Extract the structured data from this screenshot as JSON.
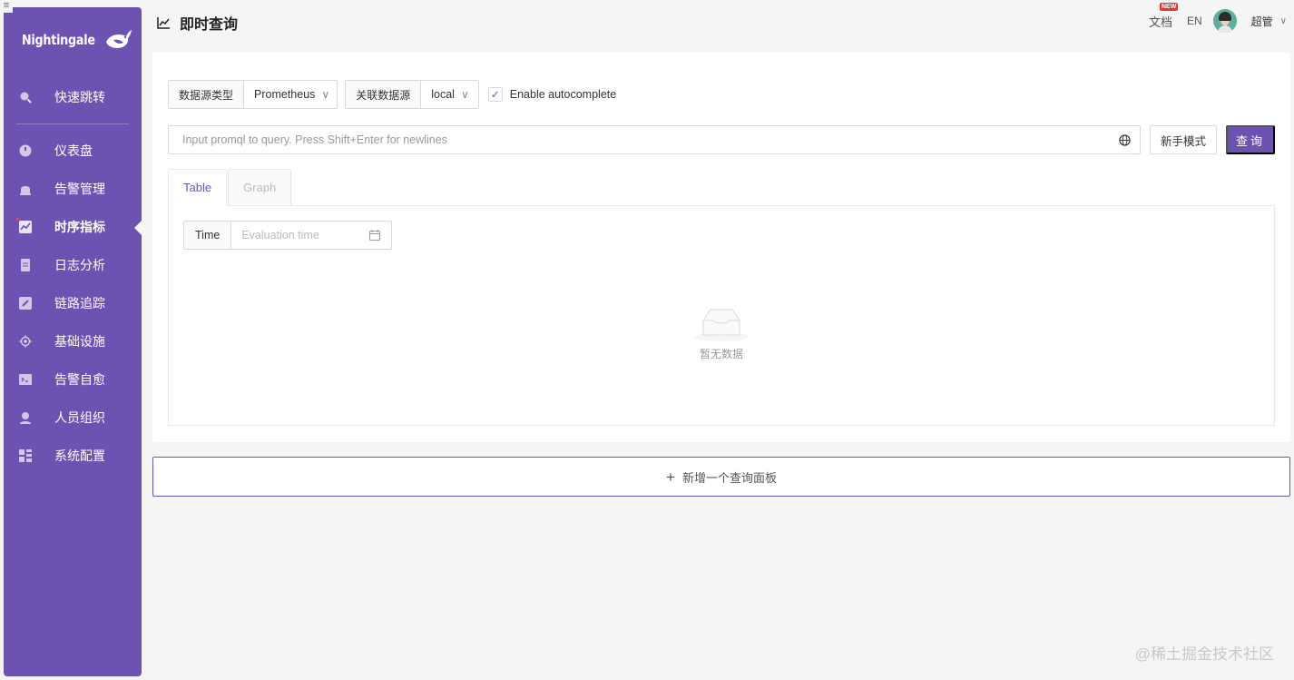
{
  "sidebar": {
    "logo_text": "Nightingale",
    "collapse_icon": "menu-lines-icon",
    "items": [
      {
        "label": "快速跳转",
        "icon": "search-icon",
        "active": false
      },
      {
        "label": "仪表盘",
        "icon": "dashboard-icon",
        "active": false
      },
      {
        "label": "告警管理",
        "icon": "alarm-icon",
        "active": false
      },
      {
        "label": "时序指标",
        "icon": "line-chart-icon",
        "active": true
      },
      {
        "label": "日志分析",
        "icon": "document-icon",
        "active": false
      },
      {
        "label": "链路追踪",
        "icon": "edit-trace-icon",
        "active": false
      },
      {
        "label": "基础设施",
        "icon": "target-icon",
        "active": false
      },
      {
        "label": "告警自愈",
        "icon": "terminal-icon",
        "active": false
      },
      {
        "label": "人员组织",
        "icon": "user-icon",
        "active": false
      },
      {
        "label": "系统配置",
        "icon": "grid-settings-icon",
        "active": false
      }
    ]
  },
  "header": {
    "title": "即时查询",
    "doc_link": "文档",
    "new_badge": "NEW",
    "lang": "EN",
    "username": "超管"
  },
  "query": {
    "datasource_type_label": "数据源类型",
    "datasource_type_value": "Prometheus",
    "linked_datasource_label": "关联数据源",
    "linked_datasource_value": "local",
    "autocomplete_label": "Enable autocomplete",
    "autocomplete_checked": true,
    "promql_placeholder": "Input promql to query. Press Shift+Enter for newlines",
    "novice_mode_button": "新手模式",
    "query_button": "查询",
    "tabs": [
      {
        "label": "Table",
        "active": true
      },
      {
        "label": "Graph",
        "active": false
      }
    ],
    "time_label": "Time",
    "time_placeholder": "Evaluation time",
    "empty_text": "暂无数据"
  },
  "add_panel_label": "新增一个查询面板",
  "watermark": "@稀土掘金技术社区",
  "colors": {
    "primary": "#6c53b1",
    "background": "#f5f5f5",
    "badge": "#e53935"
  }
}
